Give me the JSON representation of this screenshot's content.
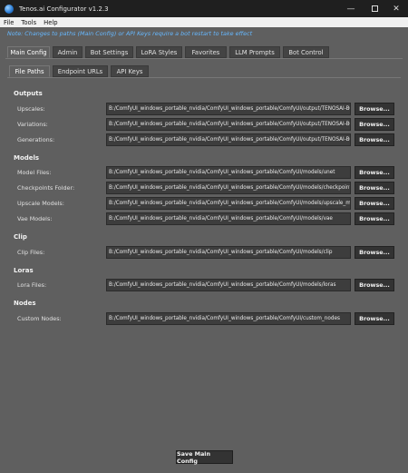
{
  "window": {
    "title": "Tenos.ai Configurator v1.2.3"
  },
  "menu": [
    "File",
    "Tools",
    "Help"
  ],
  "note": "Note: Changes to paths (Main Config) or API Keys require a bot restart to take effect",
  "main_tabs": [
    "Main Config",
    "Admin",
    "Bot Settings",
    "LoRA Styles",
    "Favorites",
    "LLM Prompts",
    "Bot Control"
  ],
  "sub_tabs": [
    "File Paths",
    "Endpoint URLs",
    "API Keys"
  ],
  "browse_label": "Browse...",
  "sections": [
    {
      "title": "Outputs",
      "rows": [
        {
          "label": "Upscales:",
          "value": "B:/ComfyUI_windows_portable_nvidia/ComfyUI_windows_portable/ComfyUI/output/TENOSAI-BOT_UPSCALES"
        },
        {
          "label": "Variations:",
          "value": "B:/ComfyUI_windows_portable_nvidia/ComfyUI_windows_portable/ComfyUI/output/TENOSAI-BOT_VARIATIONS"
        },
        {
          "label": "Generations:",
          "value": "B:/ComfyUI_windows_portable_nvidia/ComfyUI_windows_portable/ComfyUI/output/TENOSAI-BOT_GENERATIONS"
        }
      ]
    },
    {
      "title": "Models",
      "rows": [
        {
          "label": "Model Files:",
          "value": "B:/ComfyUI_windows_portable_nvidia/ComfyUI_windows_portable/ComfyUI/models/unet"
        },
        {
          "label": "Checkpoints Folder:",
          "value": "B:/ComfyUI_windows_portable_nvidia/ComfyUI_windows_portable/ComfyUI/models/checkpoints"
        },
        {
          "label": "Upscale Models:",
          "value": "B:/ComfyUI_windows_portable_nvidia/ComfyUI_windows_portable/ComfyUI/models/upscale_models"
        },
        {
          "label": "Vae Models:",
          "value": "B:/ComfyUI_windows_portable_nvidia/ComfyUI_windows_portable/ComfyUI/models/vae"
        }
      ]
    },
    {
      "title": "Clip",
      "rows": [
        {
          "label": "Clip Files:",
          "value": "B:/ComfyUI_windows_portable_nvidia/ComfyUI_windows_portable/ComfyUI/models/clip"
        }
      ]
    },
    {
      "title": "Loras",
      "rows": [
        {
          "label": "Lora Files:",
          "value": "B:/ComfyUI_windows_portable_nvidia/ComfyUI_windows_portable/ComfyUI/models/loras"
        }
      ]
    },
    {
      "title": "Nodes",
      "rows": [
        {
          "label": "Custom Nodes:",
          "value": "B:/ComfyUI_windows_portable_nvidia/ComfyUI_windows_portable/ComfyUI/custom_nodes"
        }
      ]
    }
  ],
  "save_label": "Save Main Config"
}
